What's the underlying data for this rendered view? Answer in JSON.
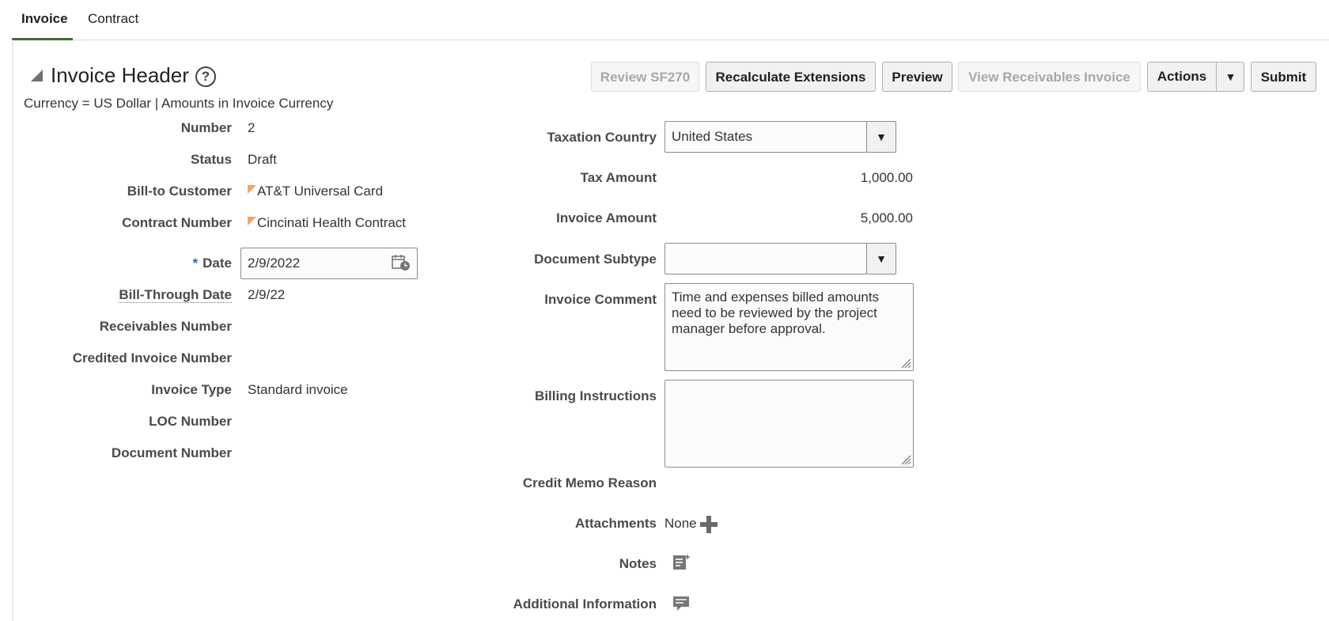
{
  "tabs": [
    {
      "label": "Invoice",
      "active": true
    },
    {
      "label": "Contract",
      "active": false
    }
  ],
  "header": {
    "title": "Invoice Header",
    "help_icon": "question-circle-icon",
    "currency_note": "Currency = US Dollar | Amounts in Invoice Currency"
  },
  "toolbar": {
    "review_sf270": "Review SF270",
    "recalculate": "Recalculate Extensions",
    "preview": "Preview",
    "view_receivables": "View Receivables Invoice",
    "actions": "Actions",
    "submit": "Submit"
  },
  "left_form": {
    "number": {
      "label": "Number",
      "value": "2"
    },
    "status": {
      "label": "Status",
      "value": "Draft"
    },
    "bill_to_customer": {
      "label": "Bill-to Customer",
      "value": "AT&T Universal Card"
    },
    "contract_number": {
      "label": "Contract Number",
      "value": "Cincinati Health Contract"
    },
    "date": {
      "required_marker": "*",
      "label": "Date",
      "value": "2/9/2022"
    },
    "bill_through_date": {
      "label": "Bill-Through Date",
      "value": "2/9/22"
    },
    "receivables_number": {
      "label": "Receivables Number",
      "value": ""
    },
    "credited_invoice_number": {
      "label": "Credited Invoice Number",
      "value": ""
    },
    "invoice_type": {
      "label": "Invoice Type",
      "value": "Standard invoice"
    },
    "loc_number": {
      "label": "LOC Number",
      "value": ""
    },
    "document_number": {
      "label": "Document Number",
      "value": ""
    }
  },
  "right_form": {
    "taxation_country": {
      "label": "Taxation Country",
      "value": "United States"
    },
    "tax_amount": {
      "label": "Tax Amount",
      "value": "1,000.00"
    },
    "invoice_amount": {
      "label": "Invoice Amount",
      "value": "5,000.00"
    },
    "document_subtype": {
      "label": "Document Subtype",
      "value": ""
    },
    "invoice_comment": {
      "label": "Invoice Comment",
      "value": "Time and expenses billed amounts need to be reviewed by the project manager before approval."
    },
    "billing_instructions": {
      "label": "Billing Instructions",
      "value": ""
    },
    "credit_memo_reason": {
      "label": "Credit Memo Reason",
      "value": ""
    },
    "attachments": {
      "label": "Attachments",
      "value": "None"
    },
    "notes": {
      "label": "Notes"
    },
    "additional_information": {
      "label": "Additional Information"
    }
  },
  "icons": {
    "calendar": "calendar-icon",
    "add": "plus-icon",
    "notes": "notes-icon",
    "additional_info": "details-icon"
  }
}
